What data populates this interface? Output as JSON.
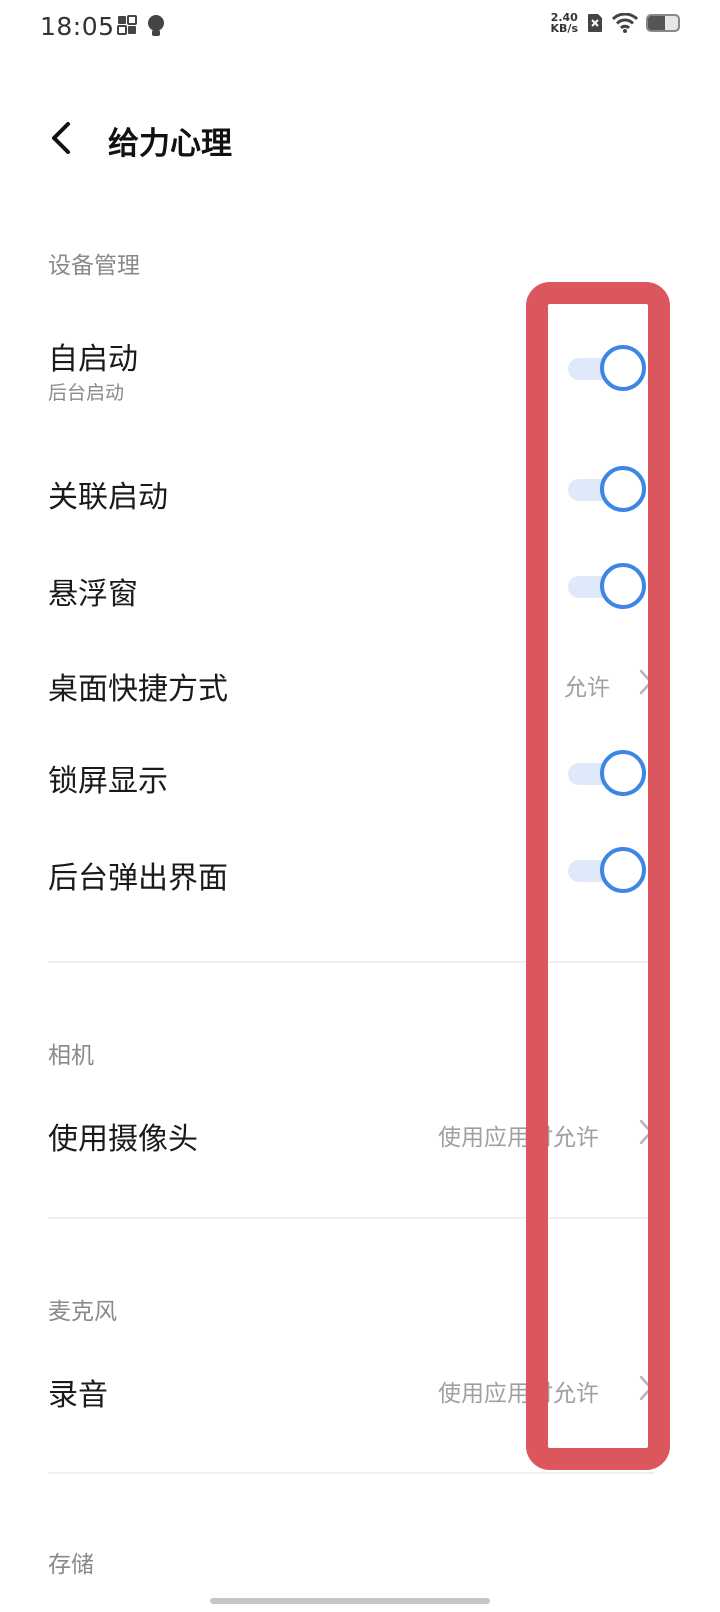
{
  "status_bar": {
    "time": "18:05",
    "net_speed_value": "2.40",
    "net_speed_unit": "KB/s",
    "left_icons": [
      "screen-record-icon",
      "bulb-icon"
    ],
    "right_icons": [
      "sim-no-signal-icon",
      "wifi-icon",
      "battery-icon"
    ]
  },
  "header": {
    "back_icon": "chevron-left-icon",
    "title": "给力心理"
  },
  "sections": {
    "device": "设备管理",
    "camera": "相机",
    "microphone": "麦克风",
    "storage": "存储"
  },
  "rows": {
    "auto_start": {
      "title": "自启动",
      "subtitle": "后台启动",
      "enabled": true
    },
    "linked_start": {
      "title": "关联启动",
      "enabled": true
    },
    "floating_window": {
      "title": "悬浮窗",
      "enabled": true
    },
    "desktop_shortcut": {
      "title": "桌面快捷方式",
      "value": "允许"
    },
    "lock_screen_display": {
      "title": "锁屏显示",
      "enabled": true
    },
    "background_popup": {
      "title": "后台弹出界面",
      "enabled": true
    },
    "use_camera": {
      "title": "使用摄像头",
      "value": "使用应用时允许"
    },
    "recording": {
      "title": "录音",
      "value": "使用应用时允许"
    }
  },
  "colors": {
    "accent": "#3d86e6",
    "toggle_track": "#dfe9fa",
    "highlight": "#dc565e"
  }
}
